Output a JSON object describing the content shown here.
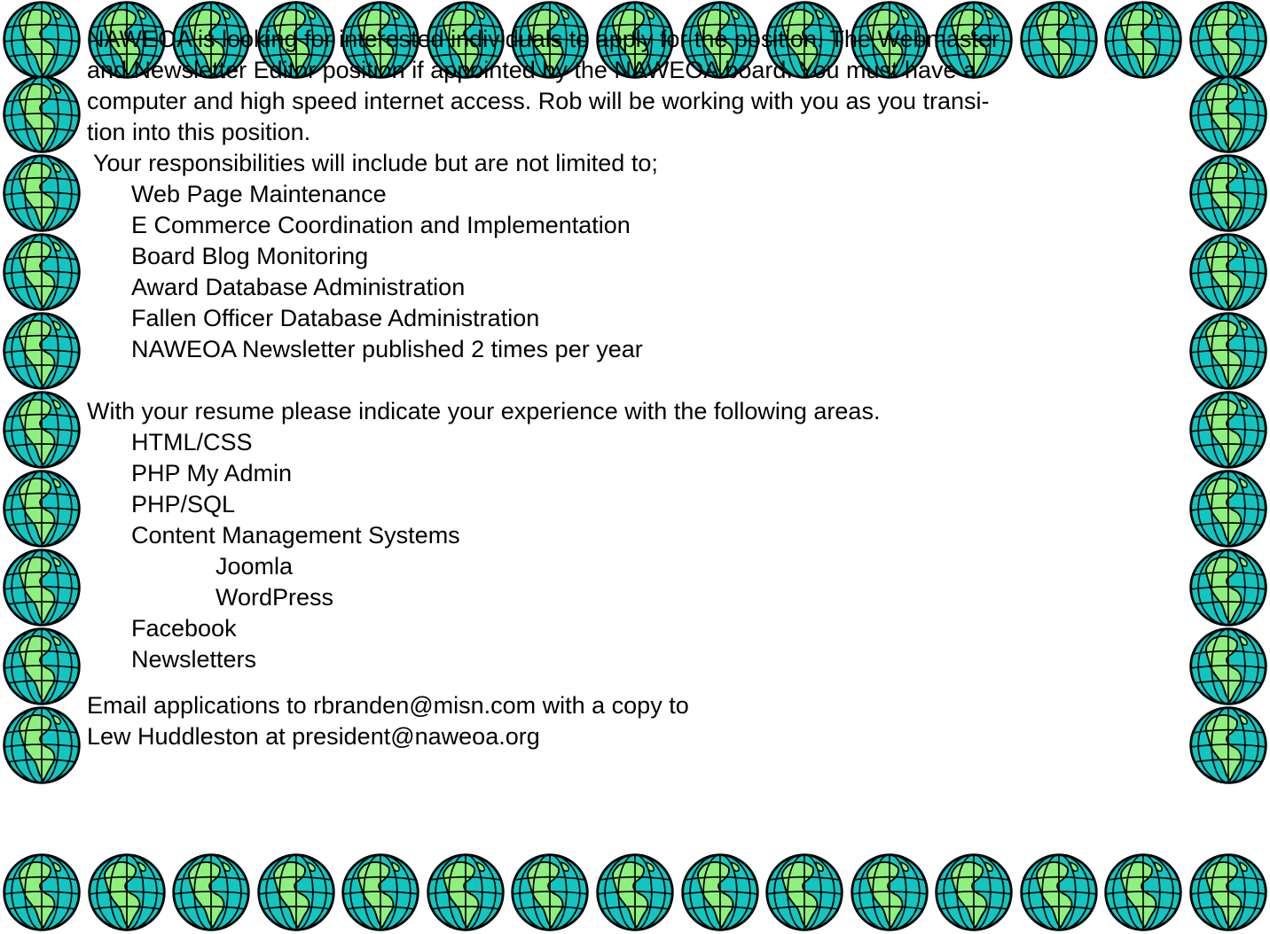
{
  "icon": "globe-icon",
  "colors": {
    "ocean": "#11c6c0",
    "land": "#8ef07d",
    "outline": "#000000",
    "text": "#000000",
    "background": "#ffffff"
  },
  "intro": {
    "line1": "NAWEOA is looking for interested individuals to apply for the position. The Webmaster",
    "line2": "and Newsletter Editor position if appointed by the NAWEOA board.   You must have a",
    "line3": "computer and high speed internet access.  Rob will be working with you as you transi-",
    "line4": "tion into this position."
  },
  "responsibilities": {
    "heading": " Your responsibilities will include but are not limited to;",
    "items": [
      "Web Page Maintenance",
      "E Commerce Coordination and Implementation",
      "Board Blog Monitoring",
      "Award Database Administration",
      "Fallen Officer Database Administration",
      "NAWEOA Newsletter published 2 times per year"
    ]
  },
  "experience": {
    "heading": "With your resume please indicate your experience with the following areas.",
    "items": [
      "HTML/CSS",
      "PHP My Admin",
      "PHP/SQL",
      "Content Management Systems"
    ],
    "cms_items": [
      "Joomla",
      "WordPress"
    ],
    "more_items": [
      "Facebook",
      "Newsletters"
    ]
  },
  "contact": {
    "line1": "Email applications to rbranden@misn.com with a copy to",
    "line2": "Lew Huddleston at president@naweoa.org"
  }
}
